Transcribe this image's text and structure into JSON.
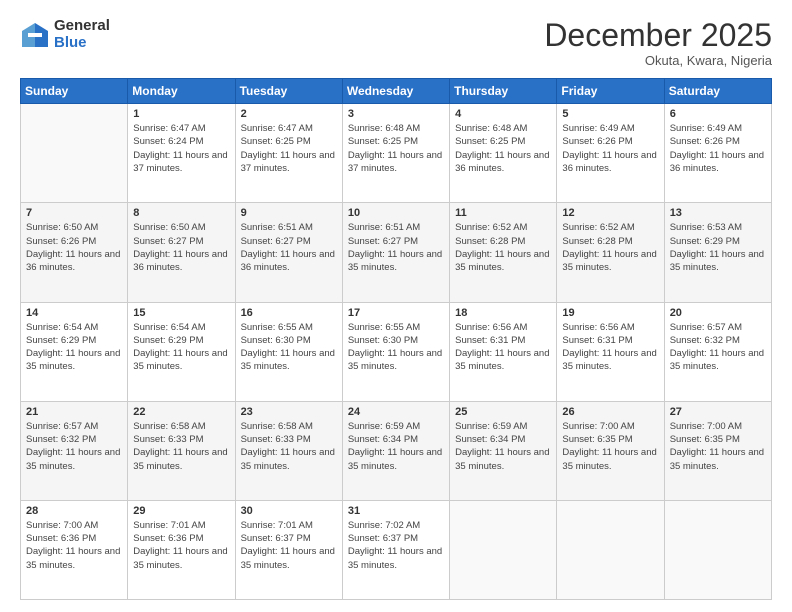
{
  "logo": {
    "general": "General",
    "blue": "Blue"
  },
  "header": {
    "month": "December 2025",
    "location": "Okuta, Kwara, Nigeria"
  },
  "days_of_week": [
    "Sunday",
    "Monday",
    "Tuesday",
    "Wednesday",
    "Thursday",
    "Friday",
    "Saturday"
  ],
  "weeks": [
    [
      {
        "day": "",
        "sunrise": "",
        "sunset": "",
        "daylight": ""
      },
      {
        "day": "1",
        "sunrise": "Sunrise: 6:47 AM",
        "sunset": "Sunset: 6:24 PM",
        "daylight": "Daylight: 11 hours and 37 minutes."
      },
      {
        "day": "2",
        "sunrise": "Sunrise: 6:47 AM",
        "sunset": "Sunset: 6:25 PM",
        "daylight": "Daylight: 11 hours and 37 minutes."
      },
      {
        "day": "3",
        "sunrise": "Sunrise: 6:48 AM",
        "sunset": "Sunset: 6:25 PM",
        "daylight": "Daylight: 11 hours and 37 minutes."
      },
      {
        "day": "4",
        "sunrise": "Sunrise: 6:48 AM",
        "sunset": "Sunset: 6:25 PM",
        "daylight": "Daylight: 11 hours and 36 minutes."
      },
      {
        "day": "5",
        "sunrise": "Sunrise: 6:49 AM",
        "sunset": "Sunset: 6:26 PM",
        "daylight": "Daylight: 11 hours and 36 minutes."
      },
      {
        "day": "6",
        "sunrise": "Sunrise: 6:49 AM",
        "sunset": "Sunset: 6:26 PM",
        "daylight": "Daylight: 11 hours and 36 minutes."
      }
    ],
    [
      {
        "day": "7",
        "sunrise": "Sunrise: 6:50 AM",
        "sunset": "Sunset: 6:26 PM",
        "daylight": "Daylight: 11 hours and 36 minutes."
      },
      {
        "day": "8",
        "sunrise": "Sunrise: 6:50 AM",
        "sunset": "Sunset: 6:27 PM",
        "daylight": "Daylight: 11 hours and 36 minutes."
      },
      {
        "day": "9",
        "sunrise": "Sunrise: 6:51 AM",
        "sunset": "Sunset: 6:27 PM",
        "daylight": "Daylight: 11 hours and 36 minutes."
      },
      {
        "day": "10",
        "sunrise": "Sunrise: 6:51 AM",
        "sunset": "Sunset: 6:27 PM",
        "daylight": "Daylight: 11 hours and 35 minutes."
      },
      {
        "day": "11",
        "sunrise": "Sunrise: 6:52 AM",
        "sunset": "Sunset: 6:28 PM",
        "daylight": "Daylight: 11 hours and 35 minutes."
      },
      {
        "day": "12",
        "sunrise": "Sunrise: 6:52 AM",
        "sunset": "Sunset: 6:28 PM",
        "daylight": "Daylight: 11 hours and 35 minutes."
      },
      {
        "day": "13",
        "sunrise": "Sunrise: 6:53 AM",
        "sunset": "Sunset: 6:29 PM",
        "daylight": "Daylight: 11 hours and 35 minutes."
      }
    ],
    [
      {
        "day": "14",
        "sunrise": "Sunrise: 6:54 AM",
        "sunset": "Sunset: 6:29 PM",
        "daylight": "Daylight: 11 hours and 35 minutes."
      },
      {
        "day": "15",
        "sunrise": "Sunrise: 6:54 AM",
        "sunset": "Sunset: 6:29 PM",
        "daylight": "Daylight: 11 hours and 35 minutes."
      },
      {
        "day": "16",
        "sunrise": "Sunrise: 6:55 AM",
        "sunset": "Sunset: 6:30 PM",
        "daylight": "Daylight: 11 hours and 35 minutes."
      },
      {
        "day": "17",
        "sunrise": "Sunrise: 6:55 AM",
        "sunset": "Sunset: 6:30 PM",
        "daylight": "Daylight: 11 hours and 35 minutes."
      },
      {
        "day": "18",
        "sunrise": "Sunrise: 6:56 AM",
        "sunset": "Sunset: 6:31 PM",
        "daylight": "Daylight: 11 hours and 35 minutes."
      },
      {
        "day": "19",
        "sunrise": "Sunrise: 6:56 AM",
        "sunset": "Sunset: 6:31 PM",
        "daylight": "Daylight: 11 hours and 35 minutes."
      },
      {
        "day": "20",
        "sunrise": "Sunrise: 6:57 AM",
        "sunset": "Sunset: 6:32 PM",
        "daylight": "Daylight: 11 hours and 35 minutes."
      }
    ],
    [
      {
        "day": "21",
        "sunrise": "Sunrise: 6:57 AM",
        "sunset": "Sunset: 6:32 PM",
        "daylight": "Daylight: 11 hours and 35 minutes."
      },
      {
        "day": "22",
        "sunrise": "Sunrise: 6:58 AM",
        "sunset": "Sunset: 6:33 PM",
        "daylight": "Daylight: 11 hours and 35 minutes."
      },
      {
        "day": "23",
        "sunrise": "Sunrise: 6:58 AM",
        "sunset": "Sunset: 6:33 PM",
        "daylight": "Daylight: 11 hours and 35 minutes."
      },
      {
        "day": "24",
        "sunrise": "Sunrise: 6:59 AM",
        "sunset": "Sunset: 6:34 PM",
        "daylight": "Daylight: 11 hours and 35 minutes."
      },
      {
        "day": "25",
        "sunrise": "Sunrise: 6:59 AM",
        "sunset": "Sunset: 6:34 PM",
        "daylight": "Daylight: 11 hours and 35 minutes."
      },
      {
        "day": "26",
        "sunrise": "Sunrise: 7:00 AM",
        "sunset": "Sunset: 6:35 PM",
        "daylight": "Daylight: 11 hours and 35 minutes."
      },
      {
        "day": "27",
        "sunrise": "Sunrise: 7:00 AM",
        "sunset": "Sunset: 6:35 PM",
        "daylight": "Daylight: 11 hours and 35 minutes."
      }
    ],
    [
      {
        "day": "28",
        "sunrise": "Sunrise: 7:00 AM",
        "sunset": "Sunset: 6:36 PM",
        "daylight": "Daylight: 11 hours and 35 minutes."
      },
      {
        "day": "29",
        "sunrise": "Sunrise: 7:01 AM",
        "sunset": "Sunset: 6:36 PM",
        "daylight": "Daylight: 11 hours and 35 minutes."
      },
      {
        "day": "30",
        "sunrise": "Sunrise: 7:01 AM",
        "sunset": "Sunset: 6:37 PM",
        "daylight": "Daylight: 11 hours and 35 minutes."
      },
      {
        "day": "31",
        "sunrise": "Sunrise: 7:02 AM",
        "sunset": "Sunset: 6:37 PM",
        "daylight": "Daylight: 11 hours and 35 minutes."
      },
      {
        "day": "",
        "sunrise": "",
        "sunset": "",
        "daylight": ""
      },
      {
        "day": "",
        "sunrise": "",
        "sunset": "",
        "daylight": ""
      },
      {
        "day": "",
        "sunrise": "",
        "sunset": "",
        "daylight": ""
      }
    ]
  ]
}
